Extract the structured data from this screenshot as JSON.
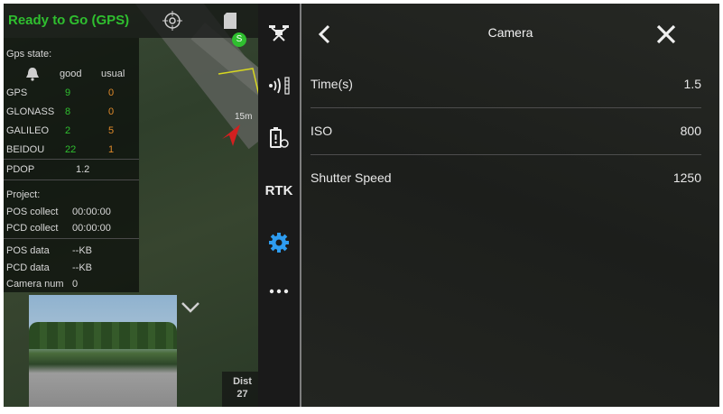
{
  "status": {
    "text": "Ready to Go (GPS)"
  },
  "gps_panel": {
    "title": "Gps state:",
    "col_good": "good",
    "col_usual": "usual",
    "rows": [
      {
        "name": "GPS",
        "good": "9",
        "usual": "0"
      },
      {
        "name": "GLONASS",
        "good": "8",
        "usual": "0"
      },
      {
        "name": "GALILEO",
        "good": "2",
        "usual": "5"
      },
      {
        "name": "BEIDOU",
        "good": "22",
        "usual": "1"
      }
    ],
    "pdop_label": "PDOP",
    "pdop_value": "1.2",
    "project_label": "Project:",
    "pos_collect_label": "POS collect",
    "pos_collect_value": "00:00:00",
    "pcd_collect_label": "PCD collect",
    "pcd_collect_value": "00:00:00",
    "pos_data_label": "POS data",
    "pos_data_value": "--KB",
    "pcd_data_label": "PCD data",
    "pcd_data_value": "--KB",
    "camera_num_label": "Camera num",
    "camera_num_value": "0"
  },
  "map": {
    "scale_label": "15m"
  },
  "distance": {
    "label": "Dist",
    "value": "27"
  },
  "toolbar": {
    "rtk_label": "RTK"
  },
  "panel": {
    "title": "Camera",
    "items": [
      {
        "label": "Time(s)",
        "value": "1.5"
      },
      {
        "label": "ISO",
        "value": "800"
      },
      {
        "label": "Shutter Speed",
        "value": "1250"
      }
    ]
  },
  "colors": {
    "accent": "#2e9cf0",
    "good": "#2fbf2f",
    "usual": "#e08a2a"
  },
  "icons": [
    "target-icon",
    "sd-card-icon",
    "drone-icon",
    "signal-icon",
    "battery-icon",
    "settings-gear-icon",
    "more-icon",
    "back-icon",
    "close-icon",
    "chevron-down-icon"
  ]
}
